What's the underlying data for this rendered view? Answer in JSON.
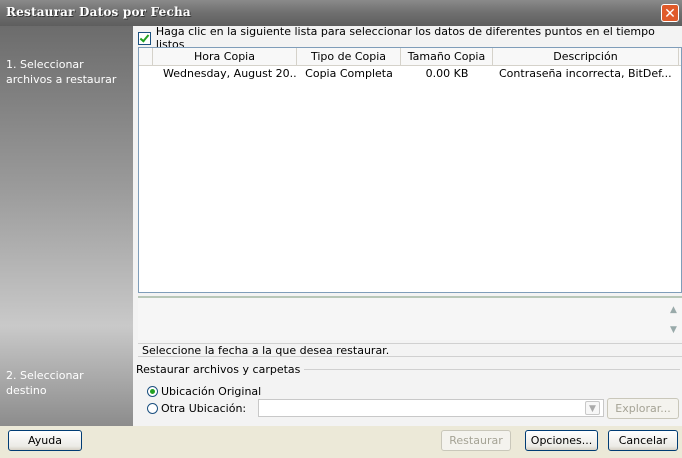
{
  "window": {
    "title": "Restaurar Datos por Fecha"
  },
  "sidebar": {
    "steps": [
      {
        "line1": "1. Seleccionar",
        "line2": "archivos a restaurar"
      },
      {
        "line1": "2. Seleccionar",
        "line2": "destino"
      }
    ]
  },
  "main": {
    "checkbox_label": "Haga clic en la siguiente lista para seleccionar los datos de diferentes puntos en el tiempo listos",
    "checkbox_checked": true,
    "columns": [
      "Hora Copia",
      "Tipo de Copia",
      "Tamaño Copia",
      "Descripción"
    ],
    "rows": [
      {
        "hora": "Wednesday, August 20...",
        "tipo": "Copia Completa",
        "tamano": "0.00 KB",
        "descripcion": "Contraseña incorrecta, BitDef..."
      }
    ],
    "status_text": "Seleccione la fecha a la que desea restaurar.",
    "restore_group_label": "Restaurar archivos y carpetas",
    "option_original": "Ubicación Original",
    "option_other": "Otra Ubicación:",
    "other_location_value": "",
    "browse_label": "Explorar..."
  },
  "footer": {
    "help_label": "Ayuda",
    "restore_label": "Restaurar",
    "options_label": "Opciones...",
    "cancel_label": "Cancelar"
  },
  "icons": {
    "close": "close-icon",
    "scroll_up": "scroll-up-icon",
    "scroll_down": "scroll-down-icon",
    "dropdown": "chevron-down-icon"
  }
}
